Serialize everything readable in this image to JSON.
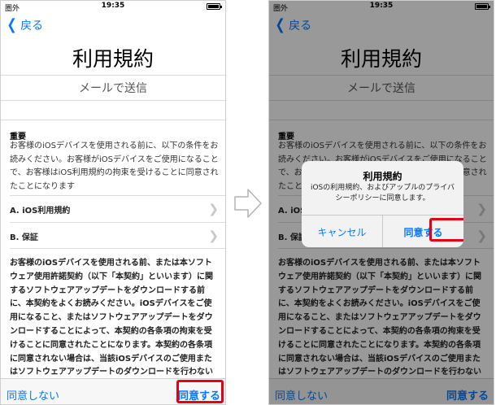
{
  "status": {
    "carrier": "圏外",
    "time": "19:35"
  },
  "nav": {
    "back_label": "戻る"
  },
  "page": {
    "title": "利用規約",
    "send_mail": "メールで送信",
    "important_heading": "重要",
    "important_text": "お客様のiOSデバイスを使用される前に、以下の条件をお読みください。お客様がiOSデバイスをご使用になることで、お客様はiOS利用規約の拘束を受けることに同意されたことになります",
    "sections": [
      {
        "label": "A. iOS利用規約"
      },
      {
        "label": "B. 保証"
      }
    ],
    "body_text": "お客様のiOSデバイスを使用される前、または本ソフトウェア使用許諾契約（以下「本契約」といいます）に関するソフトウェアアップデートをダウンロードする前に、本契約をよくお読みください。iOSデバイスをご使用になること、またはソフトウェアアップデートをダウンロードすることによって、本契約の各条項の拘束を受けることに同意されたことになります。本契約の各条項に同意されない場合は、当該iOSデバイスのご使用またはソフトウェアアップデートのダウンロードを行わないでください。"
  },
  "bottom_bar": {
    "disagree_label": "同意しない",
    "agree_label": "同意する"
  },
  "alert": {
    "title": "利用規約",
    "message": "iOSの利用規約、およびアップルのプライバシーポリシーに同意します。",
    "cancel_label": "キャンセル",
    "agree_label": "同意する"
  },
  "colors": {
    "link": "#007aff",
    "highlight": "#e60012"
  },
  "icons": {
    "back": "chevron-left-icon",
    "row": "chevron-right-icon",
    "between": "arrow-right-icon",
    "battery": "battery-icon"
  }
}
